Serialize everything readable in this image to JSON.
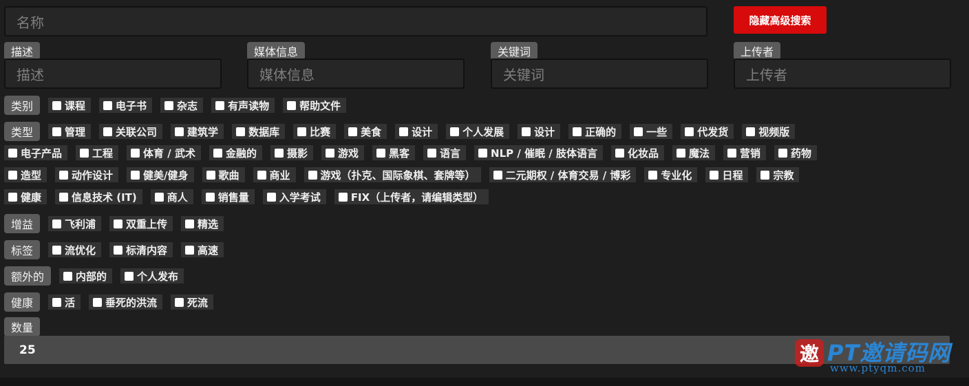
{
  "search": {
    "name_placeholder": "名称",
    "toggle_advanced": "隐藏高级搜索"
  },
  "fields": {
    "description": {
      "label": "描述",
      "placeholder": "描述"
    },
    "media": {
      "label": "媒体信息",
      "placeholder": "媒体信息"
    },
    "keywords": {
      "label": "关键词",
      "placeholder": "关键词"
    },
    "uploader": {
      "label": "上传者",
      "placeholder": "上传者"
    }
  },
  "groups": {
    "category": {
      "label": "类别",
      "options": [
        "课程",
        "电子书",
        "杂志",
        "有声读物",
        "帮助文件"
      ]
    },
    "type": {
      "label": "类型",
      "rows": [
        [
          "管理",
          "关联公司",
          "建筑学",
          "数据库",
          "比赛",
          "美食",
          "设计",
          "个人发展",
          "设计",
          "正确的",
          "一些",
          "代发货",
          "视频版"
        ],
        [
          "电子产品",
          "工程",
          "体育 / 武术",
          "金融的",
          "摄影",
          "游戏",
          "黑客",
          "语言",
          "NLP / 催眠 / 肢体语言",
          "化妆品",
          "魔法",
          "营销",
          "药物"
        ],
        [
          "造型",
          "动作设计",
          "健美/健身",
          "歌曲",
          "商业",
          "游戏（扑克、国际象棋、套牌等）",
          "二元期权 / 体育交易 / 博彩",
          "专业化",
          "日程",
          "宗教"
        ],
        [
          "健康",
          "信息技术 (IT)",
          "商人",
          "销售量",
          "入学考试",
          "FIX（上传者，请编辑类型）"
        ]
      ]
    },
    "gain": {
      "label": "增益",
      "options": [
        "飞利浦",
        "双重上传",
        "精选"
      ]
    },
    "tags": {
      "label": "标签",
      "options": [
        "流优化",
        "标清内容",
        "高速"
      ]
    },
    "extra": {
      "label": "额外的",
      "options": [
        "内部的",
        "个人发布"
      ]
    },
    "health": {
      "label": "健康",
      "options": [
        "活",
        "垂死的洪流",
        "死流"
      ]
    }
  },
  "quantity": {
    "label": "数量",
    "value": "25"
  },
  "watermark": {
    "title": "PT邀请码网",
    "url": "www.ptyqm.com",
    "logo_char": "邀"
  },
  "colors": {
    "accent_red": "#d70b0b",
    "watermark_blue": "#2a86d6"
  }
}
